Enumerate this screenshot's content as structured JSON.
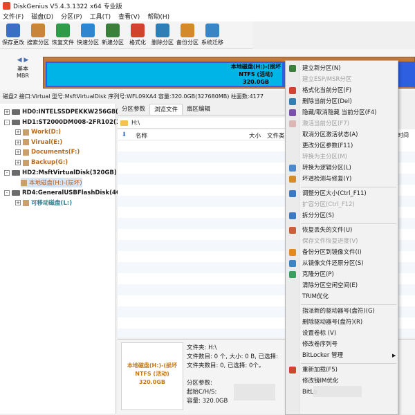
{
  "title_bar": {
    "title": "DiskGenius V5.4.3.1322 x64 专业版"
  },
  "menu": [
    "文件(F)",
    "磁盘(D)",
    "分区(P)",
    "工具(T)",
    "查看(V)",
    "帮助(H)"
  ],
  "toolbar": [
    {
      "label": "保存更改",
      "icon": "save-icon",
      "color": "#3a6fc4"
    },
    {
      "label": "搜索分区",
      "icon": "search-icon",
      "color": "#c9863a"
    },
    {
      "label": "恢复文件",
      "icon": "recover-icon",
      "color": "#2f9a47"
    },
    {
      "label": "快速分区",
      "icon": "quick-partition-icon",
      "color": "#2e86d1"
    },
    {
      "label": "新建分区",
      "icon": "new-partition-icon",
      "color": "#3a7f3a"
    },
    {
      "label": "格式化",
      "icon": "format-icon",
      "color": "#d2432e"
    },
    {
      "label": "删除分区",
      "icon": "delete-partition-icon",
      "color": "#2f7fb6"
    },
    {
      "label": "备份分区",
      "icon": "backup-icon",
      "color": "#d48a2a"
    },
    {
      "label": "系统迁移",
      "icon": "migrate-icon",
      "color": "#3a86c4"
    }
  ],
  "disk_nav": {
    "line1": "基本",
    "line2": "MBR"
  },
  "disk_strip": {
    "name": "本地磁盘(H:)-(损坏",
    "fs": "NTFS (活动)",
    "size": "320.0GB"
  },
  "disk_info": "磁盘2 接口:Virtual  型号:MsftVirtualDisk  序列号:WFL09XA4  容量:320.0GB(327680MB)  柱面数:4177",
  "tree": [
    {
      "label": "HD0:INTELSSDPEKKW256G8(2",
      "type": "disk",
      "expander": "+"
    },
    {
      "label": "HD1:ST2000DM008-2FR102(18",
      "type": "disk",
      "expander": "-"
    },
    {
      "label": "Work(D:)",
      "type": "partition",
      "expander": "+"
    },
    {
      "label": "Virual(E:)",
      "type": "partition",
      "expander": "+"
    },
    {
      "label": "Documents(F:)",
      "type": "partition",
      "expander": "+"
    },
    {
      "label": "Backup(G:)",
      "type": "partition",
      "expander": "+"
    },
    {
      "label": "HD2:MsftVirtualDisk(320GB)",
      "type": "disk",
      "expander": "-"
    },
    {
      "label": "本地磁盘(H:)-(损坏)",
      "type": "partition-selected",
      "expander": ""
    },
    {
      "label": "RD4:GeneralUSBFlashDisk(4G",
      "type": "disk",
      "expander": "-"
    },
    {
      "label": "可移动磁盘(L:)",
      "type": "removable",
      "expander": "+"
    }
  ],
  "tabs": [
    "分区参数",
    "浏览文件",
    "扇区编辑"
  ],
  "path": "H:\\",
  "columns": {
    "name": "名称",
    "size": "大小",
    "type": "文件类",
    "time": "时间"
  },
  "bottom": {
    "thumb_name": "本地磁盘(H:)-(损坏",
    "thumb_fs": "NTFS (活动)",
    "thumb_size": "320.0GB",
    "folder_line": "文件夹: H:\\",
    "files_line": "文件数目: 0 个, 大小: 0 B, 已选择:",
    "folders_line": "文件夹数目: 0, 已选择: 0个。",
    "params_title": "分区参数:",
    "chs_line": "起始C/H/S:",
    "capacity_line": "容量: 320.0GB"
  },
  "context_menu": [
    {
      "label": "建立新分区(N)",
      "icon": "new-partition-icon",
      "color": "#3a7f3a",
      "disabled": false
    },
    {
      "label": "建立ESP/MSR分区",
      "icon": "",
      "color": "",
      "disabled": true
    },
    {
      "label": "格式化当前分区(F)",
      "icon": "format-icon",
      "color": "#d2432e",
      "disabled": false
    },
    {
      "label": "删除当前分区(Del)",
      "icon": "delete-icon",
      "color": "#2f7fb6",
      "disabled": false
    },
    {
      "label": "隐藏/取消隐藏 当前分区(F4)",
      "icon": "hide-icon",
      "color": "#7a4fb0",
      "disabled": false
    },
    {
      "label": "激活当前分区(F7)",
      "icon": "activate-icon",
      "color": "#c05050",
      "disabled": true
    },
    {
      "label": "取消分区激活状态(A)",
      "icon": "",
      "color": "",
      "disabled": false
    },
    {
      "label": "更改分区参数(F11)",
      "icon": "",
      "color": "",
      "disabled": false
    },
    {
      "label": "转换为主分区(M)",
      "icon": "",
      "color": "",
      "disabled": true
    },
    {
      "label": "转换为逻辑分区(L)",
      "icon": "convert-logical-icon",
      "color": "#4a8ad0",
      "disabled": false
    },
    {
      "label": "坏道检测与修复(Y)",
      "icon": "repair-icon",
      "color": "#d88a2a",
      "disabled": false
    },
    {
      "sep": true
    },
    {
      "label": "调整分区大小(Ctrl_F11)",
      "icon": "resize-icon",
      "color": "#3a7ac4",
      "disabled": false
    },
    {
      "label": "扩容分区(Ctrl_F12)",
      "icon": "",
      "color": "",
      "disabled": true
    },
    {
      "label": "拆分分区(S)",
      "icon": "split-icon",
      "color": "#3a7ac4",
      "disabled": false
    },
    {
      "sep": true
    },
    {
      "label": "恢复丢失的文件(U)",
      "icon": "recover-file-icon",
      "color": "#c9603a",
      "disabled": false
    },
    {
      "label": "保存文件恢复进度(V)",
      "icon": "",
      "color": "",
      "disabled": true
    },
    {
      "label": "备份分区到镜像文件(I)",
      "icon": "backup-image-icon",
      "color": "#e08a20",
      "disabled": false
    },
    {
      "label": "从镜像文件还原分区(S)",
      "icon": "restore-image-icon",
      "color": "#3a86c4",
      "disabled": false
    },
    {
      "label": "克隆分区(P)",
      "icon": "clone-icon",
      "color": "#3aa060",
      "disabled": false
    },
    {
      "label": "清除分区空闲空间(E)",
      "icon": "",
      "color": "",
      "disabled": false
    },
    {
      "label": "TRIM优化",
      "icon": "",
      "color": "",
      "disabled": false
    },
    {
      "sep": true
    },
    {
      "label": "指派新的驱动器号(盘符)(G)",
      "icon": "",
      "color": "",
      "disabled": false
    },
    {
      "label": "删除驱动器号(盘符)(R)",
      "icon": "",
      "color": "",
      "disabled": false
    },
    {
      "label": "设置卷标 (V)",
      "icon": "",
      "color": "",
      "disabled": false
    },
    {
      "label": "修改卷序列号",
      "icon": "",
      "color": "",
      "disabled": false
    },
    {
      "label": "BitLocker 管理",
      "icon": "",
      "color": "",
      "disabled": false,
      "submenu": true
    },
    {
      "sep": true
    },
    {
      "label": "重新加载(F5)",
      "icon": "reload-icon",
      "color": "#d2432e",
      "disabled": false
    },
    {
      "label": "修改镜IM优化",
      "icon": "",
      "color": "",
      "disabled": false
    },
    {
      "label": "BitLo",
      "icon": "",
      "color": "",
      "disabled": false
    }
  ]
}
